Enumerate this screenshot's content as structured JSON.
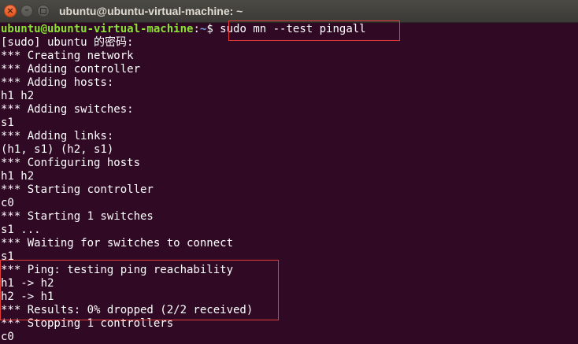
{
  "window": {
    "title": "ubuntu@ubuntu-virtual-machine: ~",
    "buttons": {
      "close": "×",
      "minimize": "–"
    }
  },
  "prompt": {
    "user_host": "ubuntu@ubuntu-virtual-machine",
    "colon": ":",
    "path": "~",
    "symbol": "$ ",
    "command": "sudo mn --test pingall"
  },
  "output_lines": [
    "[sudo] ubuntu 的密码:",
    "*** Creating network",
    "*** Adding controller",
    "*** Adding hosts:",
    "h1 h2",
    "*** Adding switches:",
    "s1",
    "*** Adding links:",
    "(h1, s1) (h2, s1)",
    "*** Configuring hosts",
    "h1 h2",
    "*** Starting controller",
    "c0",
    "*** Starting 1 switches",
    "s1 ...",
    "*** Waiting for switches to connect",
    "s1",
    "*** Ping: testing ping reachability",
    "h1 -> h2",
    "h2 -> h1",
    "*** Results: 0% dropped (2/2 received)",
    "*** Stopping 1 controllers",
    "c0"
  ],
  "colors": {
    "background": "#300a24",
    "text": "#ffffff",
    "user_host": "#8ae234",
    "path": "#729fcf",
    "highlight_box": "#e53b3b"
  }
}
